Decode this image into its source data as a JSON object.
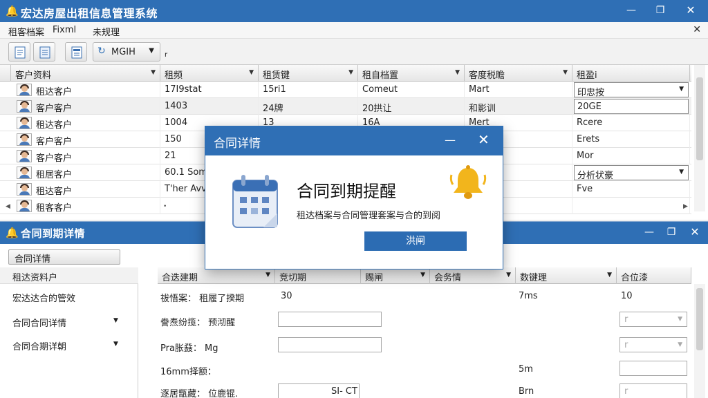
{
  "main": {
    "title": "宏达房屋出租信息管理系统",
    "menu": [
      "租客档案",
      "Fixml",
      "未规理"
    ],
    "toolbar": {
      "combo_label": "MGIH",
      "extra": "r"
    },
    "columns": [
      "客户资料",
      "租频",
      "租赁键",
      "租自档置",
      "客度税瞻",
      "租盈i"
    ],
    "rows": [
      {
        "c1": "租达客户",
        "c2": "17I9stat",
        "c3": "15ri1",
        "c4": "Comeut",
        "c5": "Mart",
        "c6": "印忠按",
        "c6_box": true,
        "c6_dd": true
      },
      {
        "c1": "客户客户",
        "c2": "1403",
        "c3": "24牌",
        "c4": "20拱让",
        "c5": "和影训",
        "c6": "20GE",
        "c6_box": true,
        "c6_dd": false
      },
      {
        "c1": "租达客户",
        "c2": "1004",
        "c3": "13",
        "c4": "16A",
        "c5": "Mert",
        "c6": "Rcere",
        "c6_box": false,
        "c6_dd": false
      },
      {
        "c1": "客户客户",
        "c2": "150",
        "c3": "",
        "c4": "",
        "c5": "",
        "c6": "Erets",
        "c6_box": false,
        "c6_dd": false
      },
      {
        "c1": "客户客户",
        "c2": "21",
        "c3": "",
        "c4": "",
        "c5": "",
        "c6": "Mor",
        "c6_box": false,
        "c6_dd": false
      },
      {
        "c1": "租居客户",
        "c2": "60.1 Som",
        "c3": "",
        "c4": "",
        "c5": "",
        "c6": "分析状豪",
        "c6_box": true,
        "c6_dd": true
      },
      {
        "c1": "租达客户",
        "c2": "T'her Avv",
        "c3": "",
        "c4": "",
        "c5": "",
        "c6": "Fve",
        "c6_box": false,
        "c6_dd": false
      },
      {
        "c1": "租客客户",
        "c2": "",
        "c3": "",
        "c4": "",
        "c5": "",
        "c6": "",
        "c6_box": false,
        "c6_dd": false
      }
    ]
  },
  "sub": {
    "title": "合同到期详情",
    "tab": "合同详情",
    "left_header": "租达资料户",
    "left_items": [
      {
        "label": "宏达达合的管效",
        "dd": false
      },
      {
        "label": "合同合同详情",
        "dd": true
      },
      {
        "label": "合同合期详朝",
        "dd": true
      }
    ],
    "columns": [
      "合迭建期",
      "竞切期",
      "赐闸",
      "会务情",
      "数键理",
      "合位漆"
    ],
    "rows": [
      {
        "label": "祓悟案： 租履了揆期",
        "input": "30",
        "c5": "7ms",
        "c6": "10"
      },
      {
        "label": "誊焘纷揽： 预沏醒",
        "input": "",
        "c5": "",
        "c6": "r"
      },
      {
        "label": "Pra胀鼗： Mg",
        "input": "",
        "c5": "",
        "c6": "r"
      },
      {
        "label": "16mm择额：",
        "input": "",
        "c5": "5m",
        "c6": ""
      },
      {
        "label": "逐居甑藏： 位鹿锟.",
        "input": "SI- CT",
        "c5": "Brn",
        "c6": "r"
      }
    ]
  },
  "dialog": {
    "title": "合同详情",
    "heading": "合同到期提醒",
    "message": "租达档案与合同管理套案与合的到阅",
    "button": "洪闸"
  },
  "colors": {
    "accent": "#2f6fb5",
    "button": "#2c6cb3",
    "bell": "#f2b51c"
  },
  "icons": [
    "bell-icon",
    "calendar-icon",
    "document-icon",
    "refresh-icon",
    "minimize-icon",
    "maximize-icon",
    "close-icon",
    "chevron-down-icon"
  ]
}
